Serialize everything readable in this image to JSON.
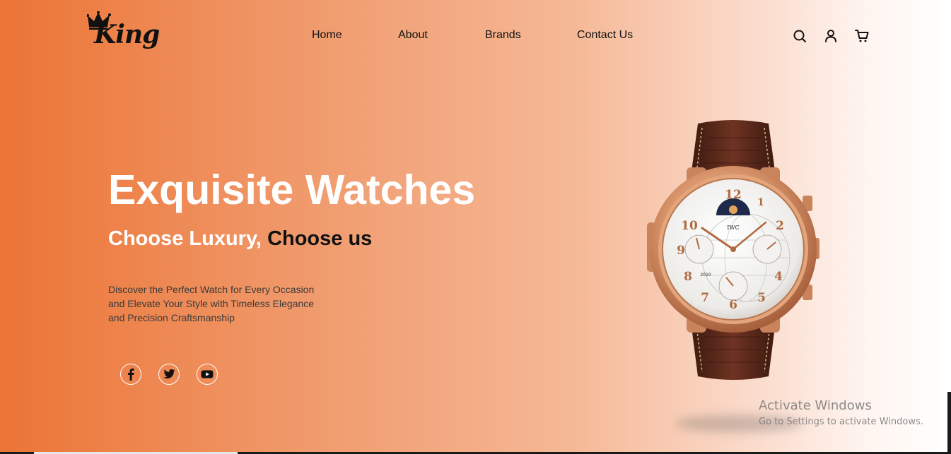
{
  "brand": {
    "logo_text": "King",
    "crown_icon": "crown-icon"
  },
  "nav": {
    "items": [
      {
        "label": "Home"
      },
      {
        "label": "About"
      },
      {
        "label": "Brands"
      },
      {
        "label": "Contact Us"
      }
    ]
  },
  "header_icons": [
    "search-icon",
    "user-icon",
    "cart-icon"
  ],
  "hero": {
    "title": "Exquisite Watches",
    "subtitle_light": "Choose Luxury,",
    "subtitle_dark": "Choose us",
    "description_lines": [
      "Discover the Perfect Watch for Every Occasion",
      "and Elevate Your Style with Timeless Elegance",
      "and Precision Craftsmanship"
    ]
  },
  "social": [
    "facebook-icon",
    "twitter-icon",
    "youtube-icon"
  ],
  "watch": {
    "brand_mark": "IWC",
    "year_window": "2010",
    "dial_numerals": [
      "12",
      "1",
      "2",
      "4",
      "5",
      "6",
      "7",
      "8",
      "9",
      "10"
    ]
  },
  "windows_watermark": {
    "title": "Activate Windows",
    "subtitle": "Go to Settings to activate Windows."
  },
  "colors": {
    "gradient_start": "#ec7436",
    "gradient_end": "#ffffff",
    "text_dark": "#111111",
    "text_white": "#ffffff",
    "watch_gold": "#d9956b",
    "strap_brown": "#5a2a1a"
  }
}
